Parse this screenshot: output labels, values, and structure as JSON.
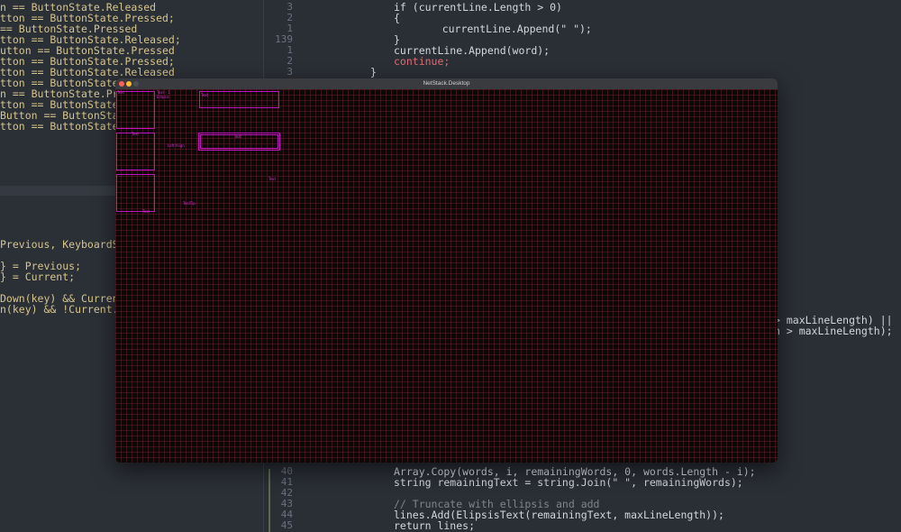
{
  "left_code": [
    {
      "text": "n == ButtonState.Released"
    },
    {
      "text": "tton == ButtonState.Pressed;"
    },
    {
      "text": "== ButtonState.Pressed"
    },
    {
      "text": "tton == ButtonState.Released;"
    },
    {
      "text": "utton == ButtonState.Pressed"
    },
    {
      "text": "tton == ButtonState.Pressed;"
    },
    {
      "text": "tton == ButtonState.Released"
    },
    {
      "text": "tton == ButtonState."
    },
    {
      "text": "n == ButtonState.Pre"
    },
    {
      "text": "tton == ButtonState."
    },
    {
      "text": "Button == ButtonStat"
    },
    {
      "text": "tton == ButtonState."
    },
    {
      "text": "Previous, KeyboardSt"
    },
    {
      "text": "} = Previous;"
    },
    {
      "text": "} = Current;"
    },
    {
      "text": "Down(key) && Current"
    },
    {
      "text": "n(key) && !Current.I"
    }
  ],
  "right_top_code": [
    {
      "num": "3",
      "text": "if (currentLine.Length > 0)"
    },
    {
      "num": "2",
      "text": "{"
    },
    {
      "num": "1",
      "text": "    currentLine.Append(\" \");"
    },
    {
      "num": "139",
      "text": "}"
    },
    {
      "num": "1",
      "text": "currentLine.Append(word);"
    },
    {
      "num": "2",
      "text": "continue;"
    },
    {
      "num": "3",
      "text": "}"
    }
  ],
  "right_mid_code": [
    {
      "text": "> maxLineLength) ||"
    },
    {
      "text": "h > maxLineLength);"
    }
  ],
  "right_bottom_code": [
    {
      "num": "40",
      "text": "Array.Copy(words, i, remainingWords, 0, words.Length - i);"
    },
    {
      "num": "41",
      "text": "string remainingText = string.Join(\" \", remainingWords);"
    },
    {
      "num": "42",
      "text": ""
    },
    {
      "num": "43",
      "text": "// Truncate with ellipsis and add"
    },
    {
      "num": "44",
      "text": "lines.Add(ElipsisText(remainingText, maxLineLength));"
    },
    {
      "num": "45",
      "text": "return lines;"
    }
  ],
  "window": {
    "title": "NetStack.Desktop",
    "labels": {
      "box1_top": "Text",
      "box1_top2": "Text - 1",
      "ellipsis": "Ellipsis",
      "box2_top": "Text",
      "box3_bottom": "Text",
      "wide1_label": "Text",
      "wide2_label": "Text",
      "left_label": "Left Align",
      "mid_text": "Text",
      "tooltip": "ToolTip"
    }
  },
  "colors": {
    "editor_bg": "#2a2e35",
    "canvas_bg": "#0b0808",
    "grid": "#96283c",
    "outline": "#c013c0"
  }
}
